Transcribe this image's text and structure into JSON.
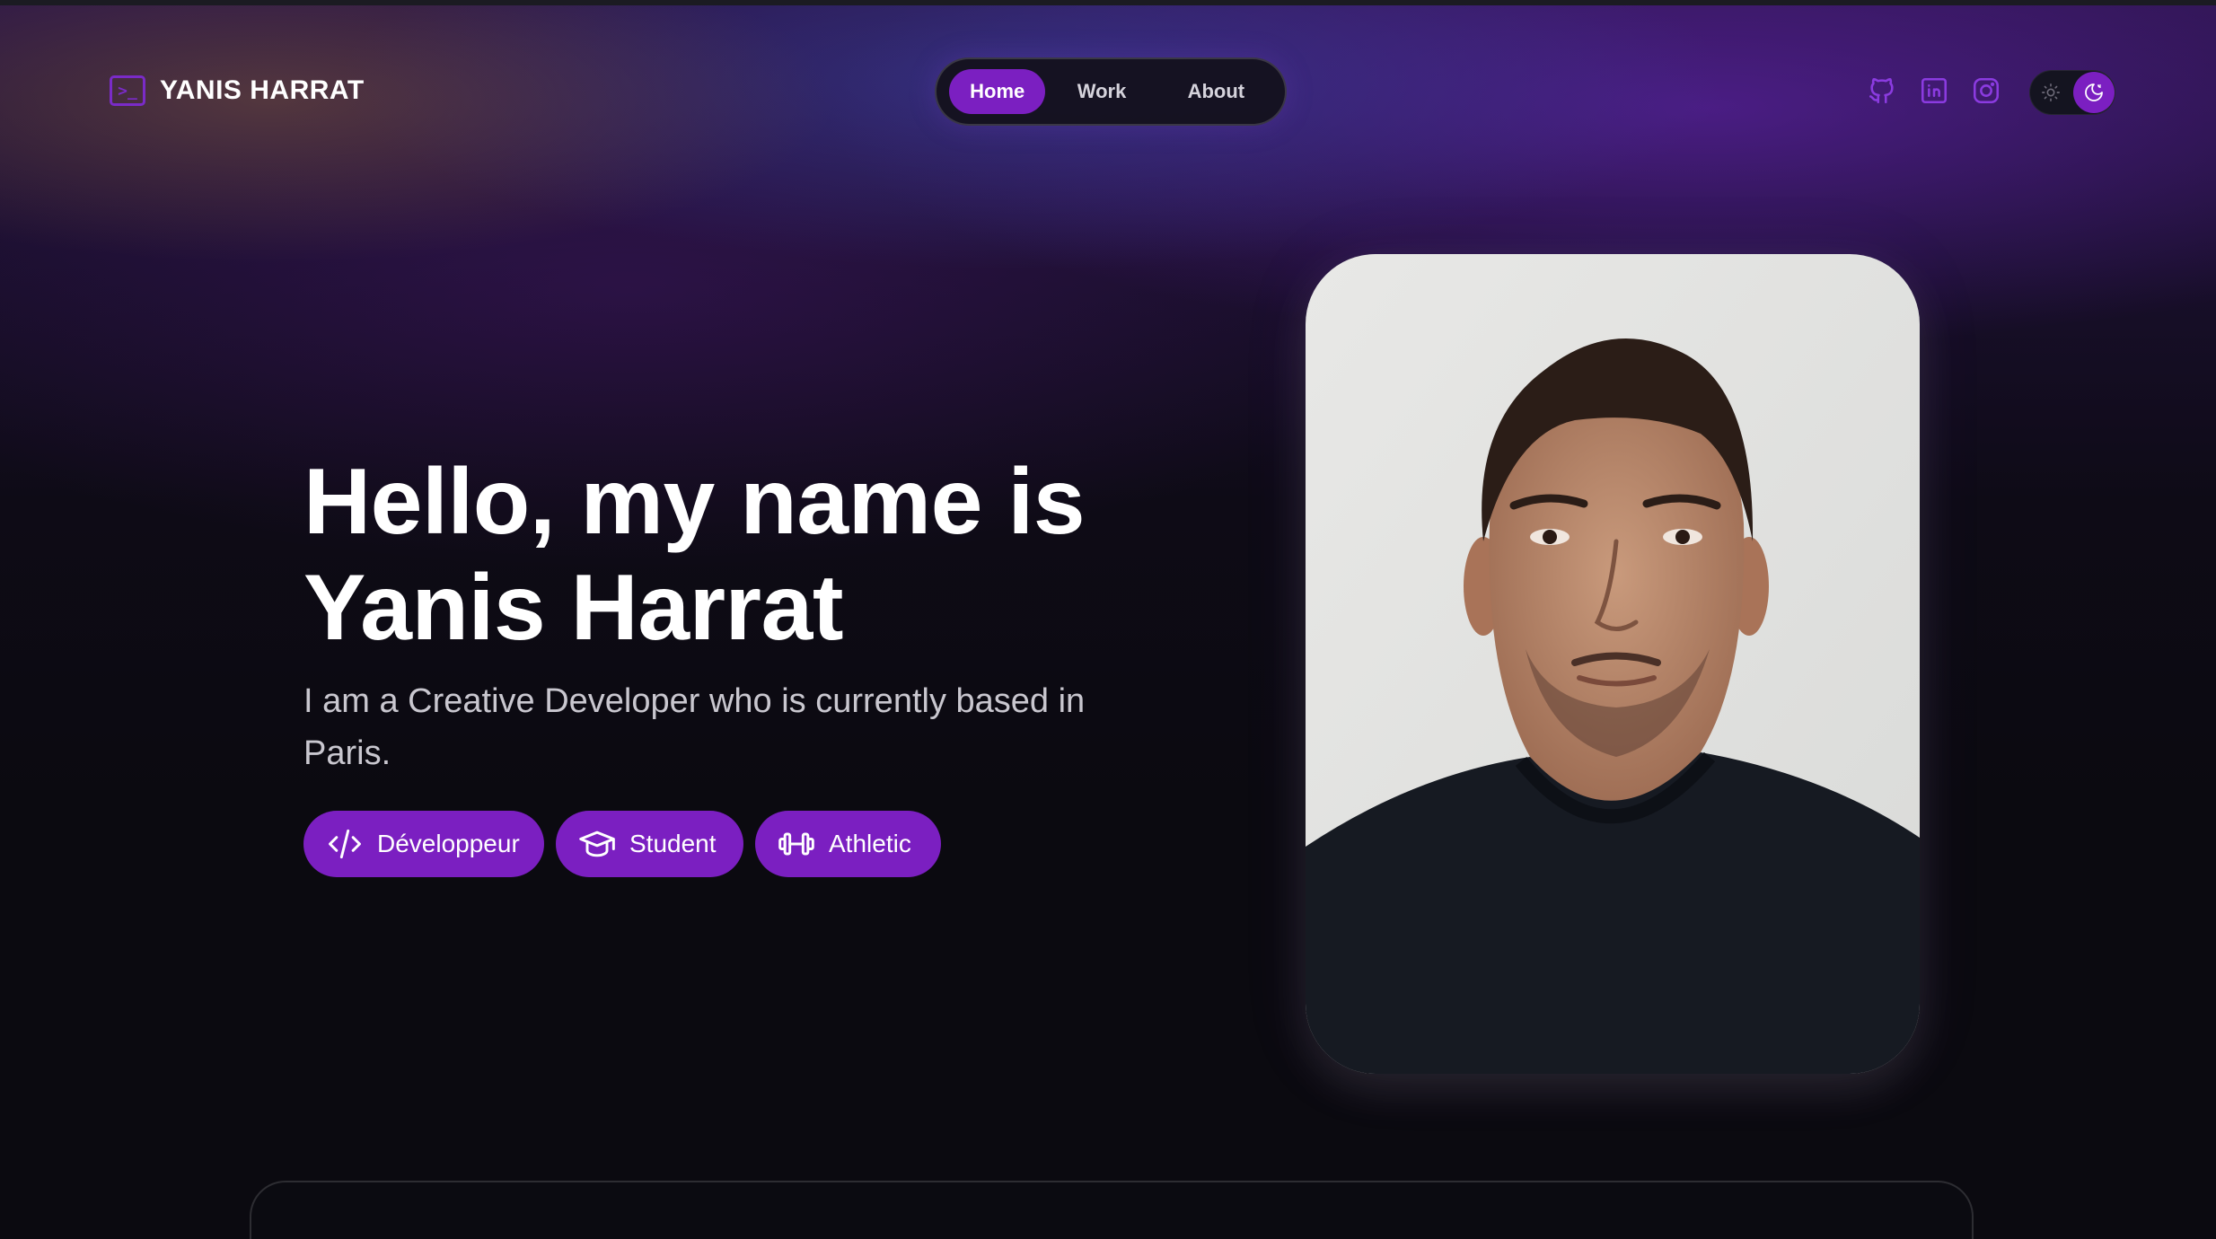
{
  "header": {
    "brand_name": "YANIS HARRAT",
    "brand_icon": "terminal-icon",
    "brand_icon_glyph": ">_"
  },
  "nav": {
    "items": [
      {
        "label": "Home",
        "active": true
      },
      {
        "label": "Work",
        "active": false
      },
      {
        "label": "About",
        "active": false
      }
    ]
  },
  "socials": [
    {
      "name": "github-icon"
    },
    {
      "name": "linkedin-icon"
    },
    {
      "name": "instagram-icon"
    }
  ],
  "theme_toggle": {
    "options": [
      "sun-icon",
      "moon-icon"
    ],
    "selected": "dark"
  },
  "hero": {
    "title_line1": "Hello, my name is",
    "title_line2": "Yanis Harrat",
    "subtitle": "I am a Creative Developer who is currently based in Paris.",
    "chips": [
      {
        "label": "Développeur",
        "icon": "code-icon"
      },
      {
        "label": "Student",
        "icon": "graduation-cap-icon"
      },
      {
        "label": "Athletic",
        "icon": "dumbbell-icon"
      }
    ]
  },
  "photo": {
    "subject": "portrait-photo"
  },
  "colors": {
    "accent": "#7b1fc1",
    "background": "#0b0a10",
    "text": "#ffffff",
    "muted_text": "#c9c7cf"
  }
}
